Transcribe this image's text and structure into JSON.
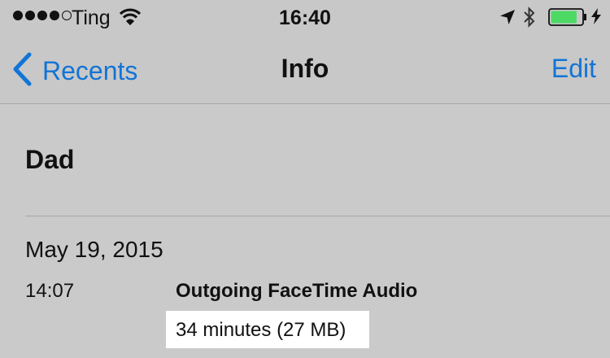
{
  "status_bar": {
    "signal_bars_filled": 4,
    "signal_bars_total": 5,
    "carrier": "Ting",
    "time": "16:40",
    "wifi_icon": "wifi-icon",
    "location_icon": "location-arrow-icon",
    "bluetooth_icon": "bluetooth-icon",
    "battery_icon": "battery-icon",
    "battery_level": 0.85,
    "battery_color": "#4cd964",
    "charging_icon": "charging-bolt-icon"
  },
  "nav": {
    "back_label": "Recents",
    "back_icon": "chevron-left-icon",
    "title": "Info",
    "edit_label": "Edit",
    "accent": "#1274d6"
  },
  "contact": {
    "name": "Dad"
  },
  "call": {
    "date": "May 19, 2015",
    "time": "14:07",
    "type": "Outgoing FaceTime Audio",
    "duration": "34 minutes (27 MB)"
  }
}
